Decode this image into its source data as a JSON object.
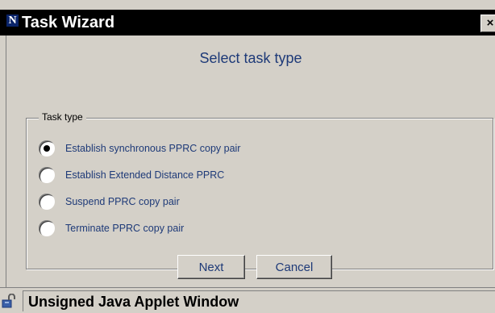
{
  "window": {
    "title": "Task Wizard",
    "icon_letter": "N",
    "close_symbol": "×"
  },
  "wizard": {
    "heading": "Select task type",
    "group_label": "Task type",
    "options": [
      {
        "label": "Establish synchronous PPRC copy pair",
        "selected": true
      },
      {
        "label": "Establish Extended Distance PPRC",
        "selected": false
      },
      {
        "label": "Suspend PPRC copy pair",
        "selected": false
      },
      {
        "label": "Terminate PPRC copy pair",
        "selected": false
      }
    ],
    "next_label": "Next",
    "cancel_label": "Cancel"
  },
  "status_bar": {
    "text": "Unsigned Java Applet Window",
    "icon": "unlocked-padlock-icon"
  },
  "colors": {
    "title_bar": "#000000",
    "window_bg": "#d4d0c8",
    "label_text": "#1e3a78"
  }
}
